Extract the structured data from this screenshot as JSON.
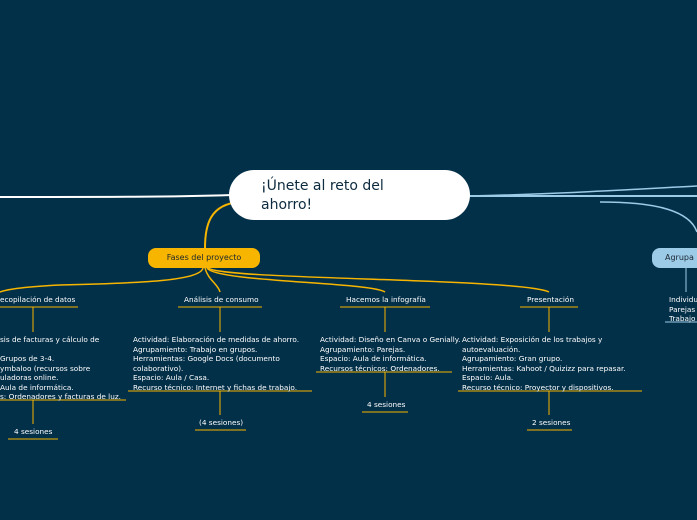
{
  "central": {
    "line1": "¡Únete al reto del",
    "line2": "ahorro!"
  },
  "branches": {
    "fases": {
      "label": "Fases del proyecto"
    },
    "agrupamiento": {
      "label": "Agrupa"
    }
  },
  "agrupamiento_items": [
    "Individu",
    "Parejas",
    "Trabajo"
  ],
  "phases": [
    {
      "title": "ecopilación de datos",
      "lines": [
        "sis de facturas y cálculo de",
        "",
        "Grupos de 3-4.",
        "ymbaloo (recursos sobre",
        "uladoras online.",
        "Aula de informática.",
        "s: Ordenadores y facturas de luz."
      ],
      "sessions": "4 sesiones"
    },
    {
      "title": "Análisis de consumo",
      "lines": [
        "Actividad: Elaboración de medidas de ahorro.",
        "Agrupamiento: Trabajo en grupos.",
        "Herramientas: Google Docs (documento",
        "colaborativo).",
        "Espacio: Aula / Casa.",
        "Recurso técnico: Internet y fichas de trabajo."
      ],
      "sessions": "(4 sesiones)"
    },
    {
      "title": "Hacemos la infografía",
      "lines": [
        "Actividad: Diseño en Canva o Genially.",
        "Agrupamiento: Parejas.",
        "Espacio: Aula de informática.",
        "Recursos técnicos: Ordenadores."
      ],
      "sessions": "4 sesiones"
    },
    {
      "title": "Presentación",
      "lines": [
        "Actividad: Exposición de los trabajos y",
        "autoevaluación.",
        "Agrupamiento: Gran grupo.",
        "Herramientas: Kahoot / Quizizz para repasar.",
        "Espacio: Aula.",
        "Recurso técnico: Proyector y dispositivos."
      ],
      "sessions": "2 sesiones"
    }
  ],
  "colors": {
    "background": "#033049",
    "central": "#ffffff",
    "fases_branch": "#f7b500",
    "agrupamiento_branch": "#9ccbe8"
  }
}
